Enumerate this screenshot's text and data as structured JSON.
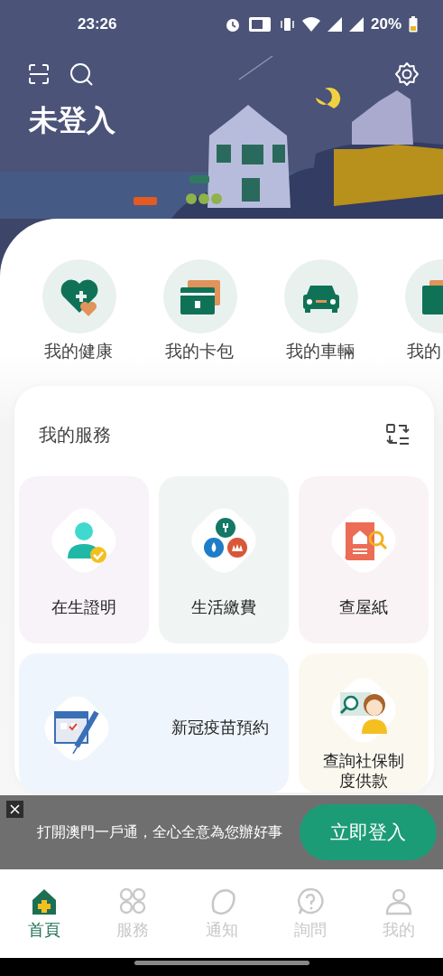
{
  "status_bar": {
    "time": "23:26",
    "battery": "20%"
  },
  "header": {
    "title": "未登入"
  },
  "shortcuts": [
    {
      "label": "我的健康"
    },
    {
      "label": "我的卡包"
    },
    {
      "label": "我的車輛"
    },
    {
      "label": "我的"
    }
  ],
  "services": {
    "title": "我的服務",
    "tiles": [
      {
        "kind": "tall",
        "label": "在生證明",
        "color": "#f7f3f8"
      },
      {
        "kind": "tall",
        "label": "生活繳費",
        "color": "#f0f5f3"
      },
      {
        "kind": "tall",
        "label": "查屋紙",
        "color": "#f9f3f6"
      },
      {
        "kind": "wide",
        "label": "新冠疫苗預約",
        "color": "#eff5fc"
      },
      {
        "kind": "tall",
        "label": "查詢社保制度供款",
        "color": "#fbf9ef"
      }
    ]
  },
  "banner": {
    "text": "打開澳門一戶通，全心全意為您辦好事",
    "button": "立即登入"
  },
  "tabs": [
    {
      "label": "首頁",
      "selected": true
    },
    {
      "label": "服務",
      "selected": false
    },
    {
      "label": "通知",
      "selected": false
    },
    {
      "label": "詢問",
      "selected": false
    },
    {
      "label": "我的",
      "selected": false
    }
  ]
}
